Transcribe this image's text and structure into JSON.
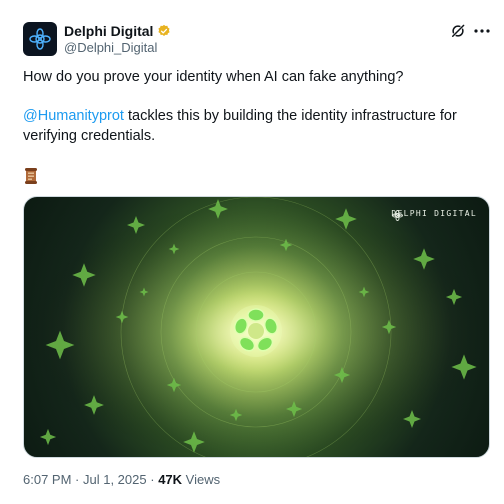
{
  "author": {
    "display_name": "Delphi Digital",
    "handle": "@Delphi_Digital"
  },
  "tweet": {
    "line1": "How do you prove your identity when AI can fake anything?",
    "mention": "@Humanityprot",
    "line2_rest": " tackles this by building the identity infrastructure for verifying credentials.",
    "emoji_icon": "scroll-icon"
  },
  "media": {
    "watermark": "DELPHI DIGITAL"
  },
  "meta": {
    "time": "6:07 PM",
    "date": "Jul 1, 2025",
    "views_count": "47K",
    "views_label": "Views"
  },
  "colors": {
    "accent": "#1d9bf0",
    "verified_gold": "#e8b321",
    "secondary_text": "#536471"
  }
}
